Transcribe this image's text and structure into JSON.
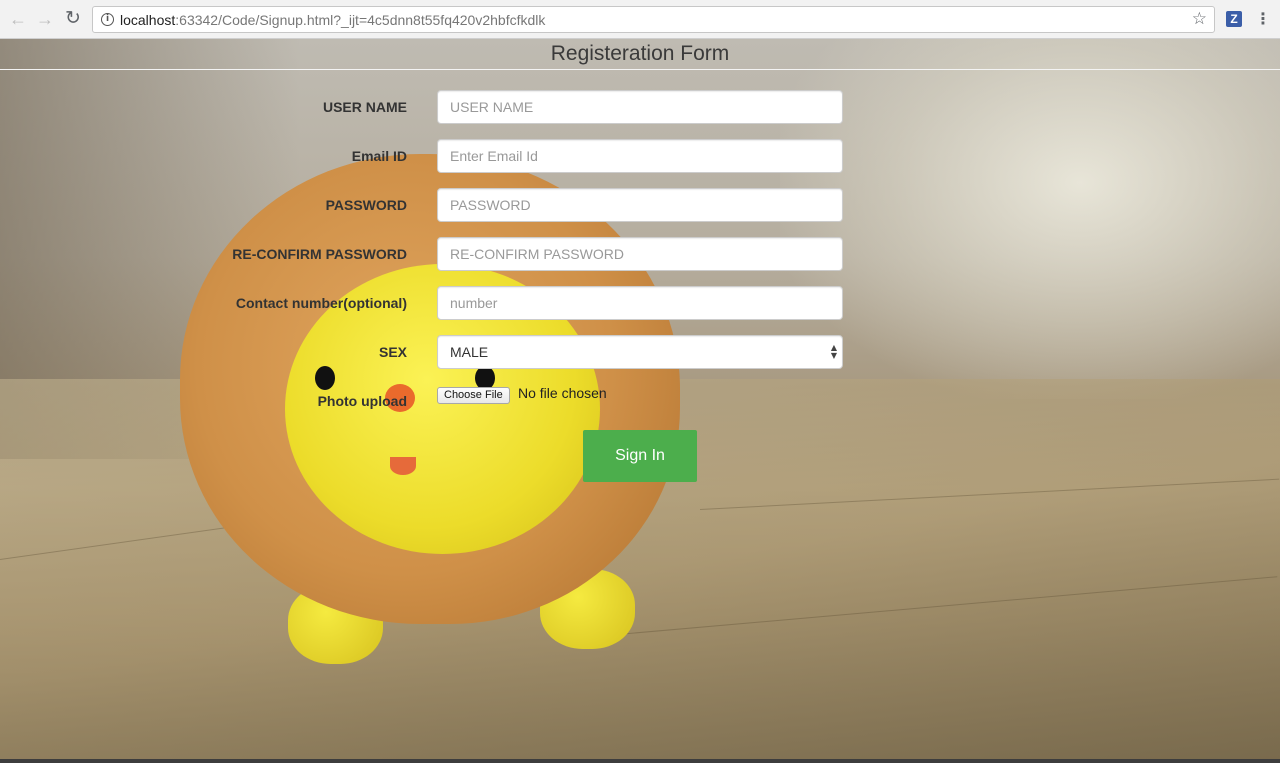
{
  "browser": {
    "url_host": "localhost",
    "url_rest": ":63342/Code/Signup.html?_ijt=4c5dnn8t55fq420v2hbfcfkdlk",
    "extension_label": "Z"
  },
  "form": {
    "title": "Registeration Form",
    "fields": [
      {
        "label": "USER NAME",
        "placeholder": "USER NAME"
      },
      {
        "label": "Email ID",
        "placeholder": "Enter Email Id"
      },
      {
        "label": "PASSWORD",
        "placeholder": "PASSWORD"
      },
      {
        "label": "RE-CONFIRM PASSWORD",
        "placeholder": "RE-CONFIRM PASSWORD"
      },
      {
        "label": "Contact number(optional)",
        "placeholder": "number"
      }
    ],
    "sex": {
      "label": "SEX",
      "selected": "MALE"
    },
    "photo": {
      "label": "Photo upload",
      "button": "Choose File",
      "status": "No file chosen"
    },
    "submit_label": "Sign In"
  },
  "colors": {
    "submit": "#4cae4c"
  }
}
